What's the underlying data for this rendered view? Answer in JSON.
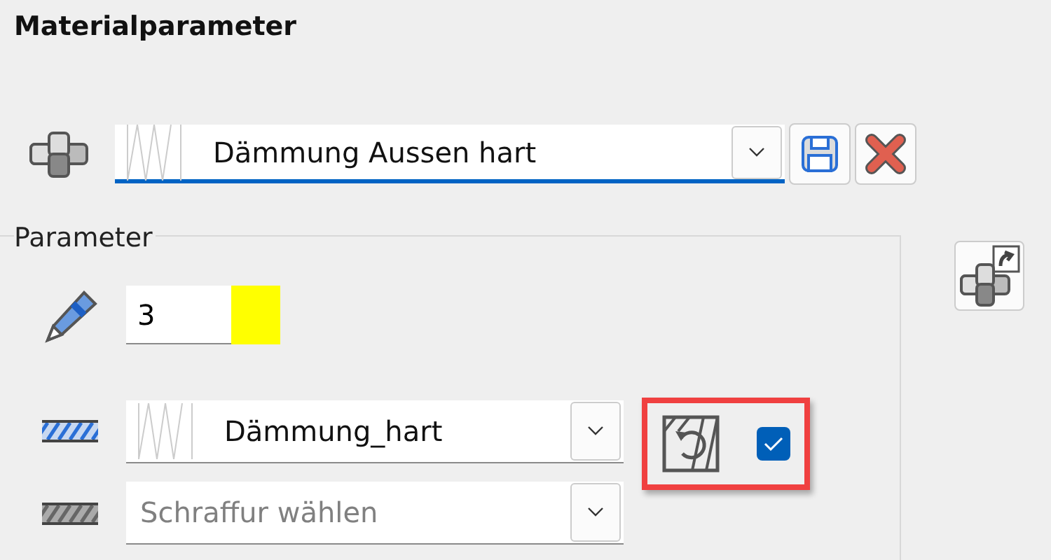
{
  "title": "Materialparameter",
  "material": {
    "value": "Dämmung Aussen hart",
    "focused": true
  },
  "parameter_group": {
    "label": "Parameter",
    "pen": {
      "value": "3",
      "color": "#ffff00"
    },
    "hatch": {
      "value": "Dämmung_hart"
    },
    "hatch2": {
      "placeholder": "Schraffur wählen"
    },
    "rotate_option": {
      "checked": true,
      "highlighted": true
    }
  }
}
